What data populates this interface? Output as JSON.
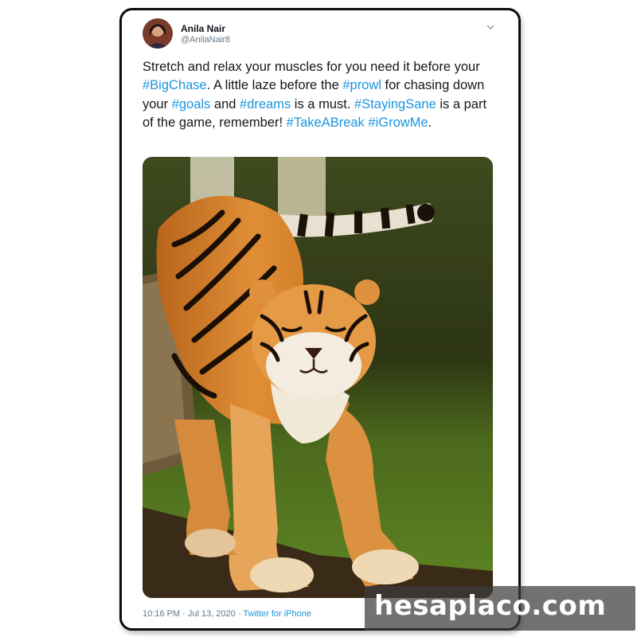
{
  "author": {
    "name": "Anila Nair",
    "handle": "@AnilaNair8"
  },
  "tweet": {
    "t1": "Stretch and relax your muscles for you need it before your ",
    "h1": "#BigChase",
    "t2": ". A little laze before the ",
    "h2": "#prowl",
    "t3": " for chasing down your ",
    "h3": "#goals",
    "t4": " and ",
    "h4": "#dreams",
    "t5": " is a must. ",
    "h5": "#StayingSane",
    "t6": " is a part of the game, remember! ",
    "h6": "#TakeABreak",
    "t7": " ",
    "h7": "#iGrowMe",
    "t8": "."
  },
  "meta": {
    "time": "10:16 PM",
    "sep": " · ",
    "date": "Jul 13, 2020",
    "source": "Twitter for iPhone"
  },
  "watermark": "hesaplaco.com",
  "icons": {
    "menu": "chevron-down-icon",
    "photo": "tiger-photo"
  },
  "colors": {
    "link": "#1b95e0",
    "text": "#14171a",
    "muted": "#657786",
    "frame": "#0c0c0c"
  }
}
